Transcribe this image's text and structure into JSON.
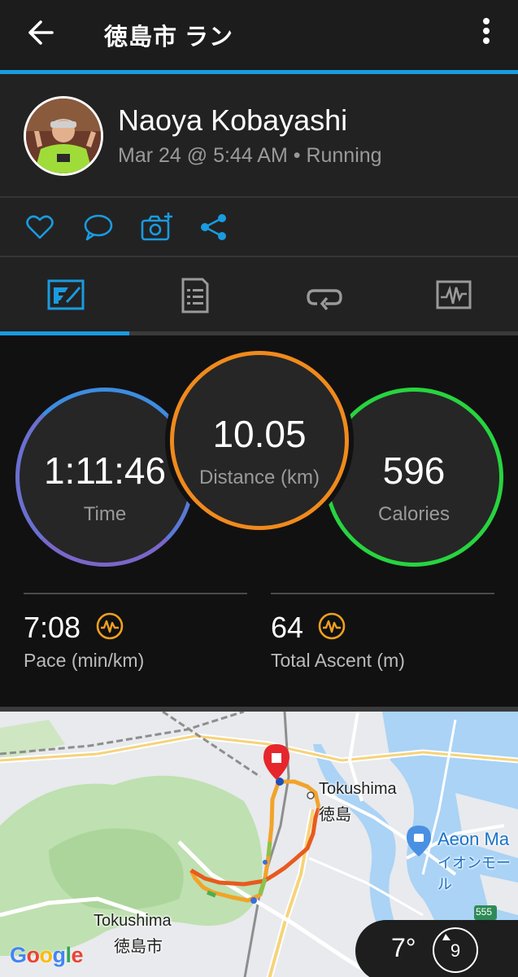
{
  "header": {
    "title": "徳島市 ラン"
  },
  "profile": {
    "name": "Naoya Kobayashi",
    "meta": "Mar 24 @ 5:44 AM • Running"
  },
  "actions": [
    "heart-icon",
    "comment-icon",
    "add-photo-icon",
    "share-icon"
  ],
  "tabs": [
    "stats-icon",
    "details-icon",
    "laps-icon",
    "charts-icon"
  ],
  "stats": {
    "time": {
      "value": "1:11:46",
      "label": "Time"
    },
    "distance": {
      "value": "10.05",
      "label": "Distance (km)"
    },
    "calories": {
      "value": "596",
      "label": "Calories"
    },
    "pace": {
      "value": "7:08",
      "label": "Pace (min/km)"
    },
    "ascent": {
      "value": "64",
      "label": "Total Ascent (m)"
    }
  },
  "map": {
    "labels": {
      "tokushima_station_en": "Tokushima",
      "tokushima_station_ja": "徳島",
      "aeon_en": "Aeon Ma",
      "aeon_ja": "イオンモール",
      "tokushima_city_en": "Tokushima",
      "tokushima_city_ja": "徳島市",
      "route_badge": "555"
    },
    "google_logo": "Google"
  },
  "weather": {
    "temperature": "7°",
    "wind": "9"
  },
  "colors": {
    "accent": "#1a9be0",
    "time_ring": "#5a78d6",
    "distance_ring": "#f08a1c",
    "calories_ring": "#27d43f",
    "icon_orange": "#f0a020"
  }
}
